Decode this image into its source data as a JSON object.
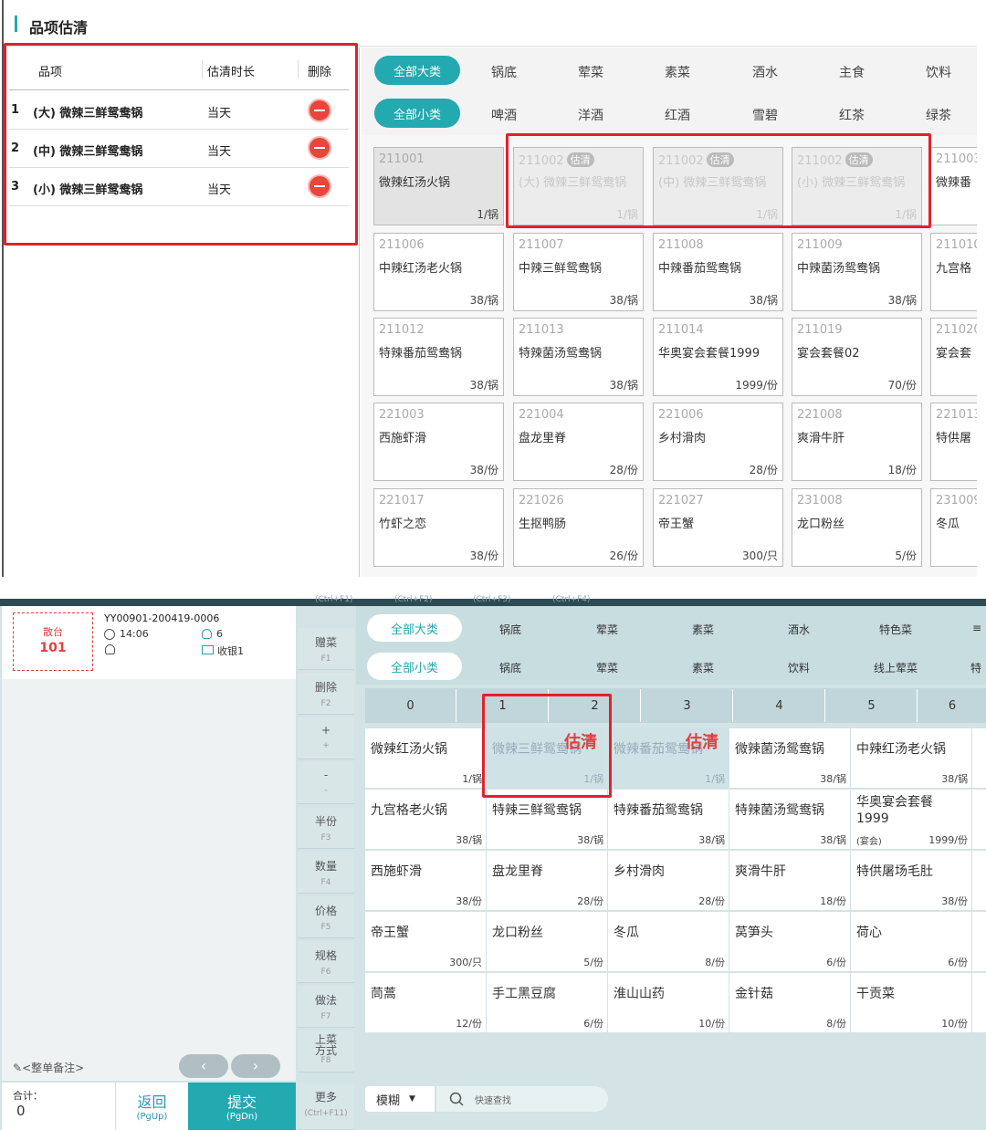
{
  "top": {
    "title": "品项估清",
    "table_headers": {
      "item": "品项",
      "duration": "估清时长",
      "delete": "删除"
    },
    "rows": [
      {
        "no": "1",
        "name": "(大) 微辣三鲜鸳鸯锅",
        "duration": "当天"
      },
      {
        "no": "2",
        "name": "(中) 微辣三鲜鸳鸯锅",
        "duration": "当天"
      },
      {
        "no": "3",
        "name": "(小) 微辣三鲜鸳鸯锅",
        "duration": "当天"
      }
    ],
    "big_categories": {
      "all": "全部大类",
      "items": [
        "锅底",
        "荤菜",
        "素菜",
        "酒水",
        "主食",
        "饮料"
      ]
    },
    "small_categories": {
      "all": "全部小类",
      "items": [
        "啤酒",
        "洋酒",
        "红酒",
        "雪碧",
        "红茶",
        "绿茶"
      ]
    },
    "estimated_tag": "估清",
    "cards": [
      {
        "code": "211001",
        "name": "微辣红汤火锅",
        "price": "1/锅"
      },
      {
        "code": "211002",
        "name": "(大) 微辣三鲜鸳鸯锅",
        "price": "1/锅"
      },
      {
        "code": "211002",
        "name": "(中) 微辣三鲜鸳鸯锅",
        "price": "1/锅"
      },
      {
        "code": "211002",
        "name": "(小) 微辣三鲜鸳鸯锅",
        "price": "1/锅"
      },
      {
        "code": "211003",
        "name": "微辣番"
      },
      {
        "code": "211006",
        "name": "中辣红汤老火锅",
        "price": "38/锅"
      },
      {
        "code": "211007",
        "name": "中辣三鲜鸳鸯锅",
        "price": "38/锅"
      },
      {
        "code": "211008",
        "name": "中辣番茄鸳鸯锅",
        "price": "38/锅"
      },
      {
        "code": "211009",
        "name": "中辣菌汤鸳鸯锅",
        "price": "38/锅"
      },
      {
        "code": "211010",
        "name": "九宫格"
      },
      {
        "code": "211012",
        "name": "特辣番茄鸳鸯锅",
        "price": "38/锅"
      },
      {
        "code": "211013",
        "name": "特辣菌汤鸳鸯锅",
        "price": "38/锅"
      },
      {
        "code": "211014",
        "name": "华奥宴会套餐1999",
        "price": "1999/份"
      },
      {
        "code": "211019",
        "name": "宴会套餐02",
        "price": "70/份"
      },
      {
        "code": "211020",
        "name": "宴会套"
      },
      {
        "code": "221003",
        "name": "西施虾滑",
        "price": "38/份"
      },
      {
        "code": "221004",
        "name": "盘龙里脊",
        "price": "28/份"
      },
      {
        "code": "221006",
        "name": "乡村滑肉",
        "price": "28/份"
      },
      {
        "code": "221008",
        "name": "爽滑牛肝",
        "price": "18/份"
      },
      {
        "code": "221013",
        "name": "特供屠"
      },
      {
        "code": "221017",
        "name": "竹虾之恋",
        "price": "38/份"
      },
      {
        "code": "221026",
        "name": "生抠鸭肠",
        "price": "26/份"
      },
      {
        "code": "221027",
        "name": "帝王蟹",
        "price": "300/只"
      },
      {
        "code": "231008",
        "name": "龙口粉丝",
        "price": "5/份"
      },
      {
        "code": "231009",
        "name": "冬瓜"
      }
    ]
  },
  "bottom": {
    "top_shortcuts": [
      "(Ctrl+F1)",
      "(Ctrl+F2)",
      "(Ctrl+F3)",
      "(Ctrl+F4)"
    ],
    "order": {
      "table_type": "散台",
      "table_no": "101",
      "order_no": "YY00901-200419-0006",
      "time": "14:06",
      "guests": "6",
      "cashier": "收银1"
    },
    "note": "<整单备注>",
    "total_label": "合计：",
    "total_value": "0",
    "back": {
      "label": "返回",
      "key": "(PgUp)"
    },
    "submit": {
      "label": "提交",
      "key": "(PgDn)"
    },
    "func_buttons": [
      {
        "label": "赠菜",
        "key": "F1"
      },
      {
        "label": "删除",
        "key": "F2"
      },
      {
        "label": "+",
        "key": "+"
      },
      {
        "label": "-",
        "key": "-"
      },
      {
        "label": "半份",
        "key": "F3"
      },
      {
        "label": "数量",
        "key": "F4"
      },
      {
        "label": "价格",
        "key": "F5"
      },
      {
        "label": "规格",
        "key": "F6"
      },
      {
        "label": "做法",
        "key": "F7"
      },
      {
        "label": "上菜方式",
        "key": "F8"
      },
      {
        "label": "更多",
        "key": "(Ctrl+F11)"
      }
    ],
    "big_categories": {
      "all": "全部大类",
      "items": [
        "锅底",
        "荤菜",
        "素菜",
        "酒水",
        "特色菜"
      ]
    },
    "small_categories": {
      "all": "全部小类",
      "items": [
        "锅底",
        "荤菜",
        "素菜",
        "饮料",
        "线上荤菜",
        "特"
      ]
    },
    "numbers": [
      "0",
      "1",
      "2",
      "3",
      "4",
      "5",
      "6"
    ],
    "estimated_tag": "估清",
    "cards": [
      {
        "name": "微辣红汤火锅",
        "price": "1/锅"
      },
      {
        "name": "微辣三鲜鸳鸯锅",
        "price": "1/锅"
      },
      {
        "name": "微辣番茄鸳鸯锅",
        "price": "1/锅"
      },
      {
        "name": "微辣菌汤鸳鸯锅",
        "price": "38/锅"
      },
      {
        "name": "中辣红汤老火锅",
        "price": "38/锅"
      },
      {
        "name": "九宫格老火锅",
        "price": "38/锅"
      },
      {
        "name": "特辣三鲜鸳鸯锅",
        "price": "38/锅"
      },
      {
        "name": "特辣番茄鸳鸯锅",
        "price": "38/锅"
      },
      {
        "name": "特辣菌汤鸳鸯锅",
        "price": "38/锅"
      },
      {
        "name": "华奥宴会套餐1999",
        "price": "1999/份",
        "sub": "(宴会)"
      },
      {
        "name": "西施虾滑",
        "price": "38/份"
      },
      {
        "name": "盘龙里脊",
        "price": "28/份"
      },
      {
        "name": "乡村滑肉",
        "price": "28/份"
      },
      {
        "name": "爽滑牛肝",
        "price": "18/份"
      },
      {
        "name": "特供屠场毛肚",
        "price": "38/份"
      },
      {
        "name": "帝王蟹",
        "price": "300/只"
      },
      {
        "name": "龙口粉丝",
        "price": "5/份"
      },
      {
        "name": "冬瓜",
        "price": "8/份"
      },
      {
        "name": "莴笋头",
        "price": "6/份"
      },
      {
        "name": "荷心",
        "price": "6/份"
      },
      {
        "name": "茼蒿",
        "price": "12/份"
      },
      {
        "name": "手工黑豆腐",
        "price": "6/份"
      },
      {
        "name": "淮山山药",
        "price": "10/份"
      },
      {
        "name": "金针菇",
        "price": "8/份"
      },
      {
        "name": "干贡菜",
        "price": "10/份"
      }
    ],
    "search": {
      "mode": "模糊",
      "placeholder": "快速查找"
    }
  }
}
